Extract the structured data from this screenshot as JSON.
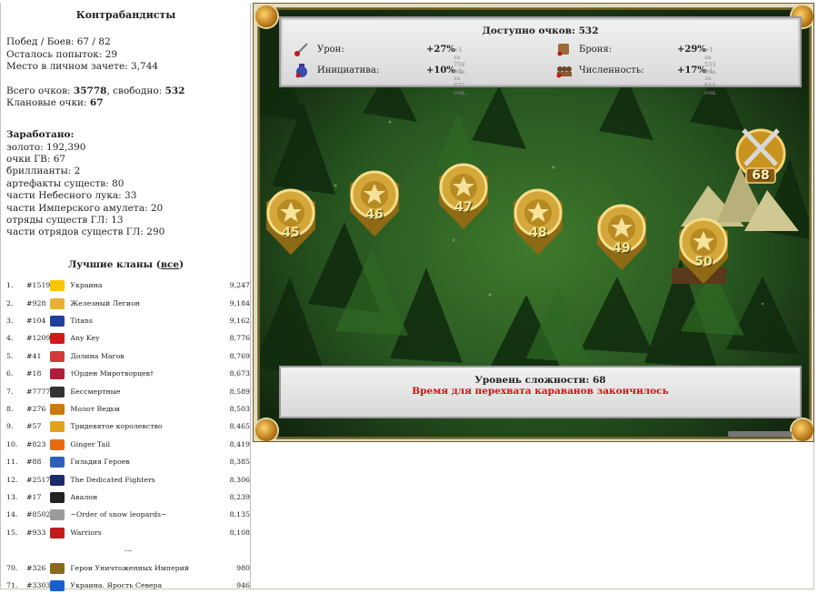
{
  "left": {
    "title": "Контрабандисты",
    "stats": [
      "Побед / Боев: 67 / 82",
      "Осталось попыток: 29",
      "Место в личном зачете: 3,744"
    ],
    "points_prefix": "Всего очков: ",
    "points_total": "35778",
    "points_mid": ", свободно: ",
    "points_free": "532",
    "clan_points_prefix": "Клановые очки: ",
    "clan_points": "67",
    "earned_title": "Заработано:",
    "earned": [
      "золото: 192,390",
      "очки ГВ: 67",
      "бриллианты: 2",
      "артефакты существ: 80",
      "части Небесного лука: 33",
      "части Имперского амулета: 20",
      "отряды существ ГЛ: 13",
      "части отрядов существ ГЛ: 290"
    ],
    "clans_title": "Лучшие кланы (",
    "clans_link": "все",
    "clans_title_end": ")",
    "clans": [
      {
        "rank": "1.",
        "id": "#1519",
        "name": "Украина",
        "score": "9,247",
        "color": "#f7c600",
        "icon": "ukraine-flag-icon"
      },
      {
        "rank": "2.",
        "id": "#928",
        "name": "Железный Легион",
        "score": "9,184",
        "color": "#e8b038",
        "icon": "smiley-icon"
      },
      {
        "rank": "3.",
        "id": "#104",
        "name": "Titans",
        "score": "9,162",
        "color": "#1f3f9a",
        "icon": "titans-icon"
      },
      {
        "rank": "4.",
        "id": "#1209",
        "name": "Any Key",
        "score": "8,776",
        "color": "#d01a1a",
        "icon": "at-sign-icon"
      },
      {
        "rank": "5.",
        "id": "#41",
        "name": "Долина Магов",
        "score": "8,769",
        "color": "#d23a3a",
        "icon": "star-icon"
      },
      {
        "rank": "6.",
        "id": "#18",
        "name": "†Орден Миротворцев†",
        "score": "8,673",
        "color": "#b01d3a",
        "icon": "flag-icon"
      },
      {
        "rank": "7.",
        "id": "#7777",
        "name": "Бессмертные",
        "score": "8,589",
        "color": "#333333",
        "icon": "bat-icon"
      },
      {
        "rank": "8.",
        "id": "#276",
        "name": "Молот Ведьм",
        "score": "8,503",
        "color": "#c97a10",
        "icon": "hammer-icon"
      },
      {
        "rank": "9.",
        "id": "#57",
        "name": "Тридевятое королевство",
        "score": "8,465",
        "color": "#e0a21a",
        "icon": "crown-icon"
      },
      {
        "rank": "10.",
        "id": "#823",
        "name": "Ginger Tail",
        "score": "8,419",
        "color": "#e86a10",
        "icon": "fox-icon"
      },
      {
        "rank": "11.",
        "id": "#88",
        "name": "Гильдия Героев",
        "score": "8,385",
        "color": "#2d5fb8",
        "icon": "shield-icon"
      },
      {
        "rank": "12.",
        "id": "#2517",
        "name": "The Dedicated Fighters",
        "score": "8,306",
        "color": "#1b2a6a",
        "icon": "fighters-icon"
      },
      {
        "rank": "13.",
        "id": "#17",
        "name": "Авалон",
        "score": "8,239",
        "color": "#222222",
        "icon": "knight-icon"
      },
      {
        "rank": "14.",
        "id": "#8502",
        "name": "~Order of snow leopards~",
        "score": "8,135",
        "color": "#9a9a9a",
        "icon": "leopard-icon"
      },
      {
        "rank": "15.",
        "id": "#933",
        "name": "Warriors",
        "score": "8,108",
        "color": "#c01a1a",
        "icon": "warriors-icon"
      }
    ],
    "ellipsis": "...",
    "clans_tail": [
      {
        "rank": "70.",
        "id": "#326",
        "name": "Герои Уничтоженных Империй",
        "score": "980",
        "color": "#8a6a20",
        "icon": "ankh-icon"
      },
      {
        "rank": "71.",
        "id": "#3303",
        "name": "Украина. Ярость Севера",
        "score": "946",
        "color": "#1a5fd0",
        "icon": "ukraine-flag-icon"
      }
    ]
  },
  "game": {
    "available_prefix": "Доступно очков: ",
    "available": "532",
    "stats": {
      "damage": {
        "label": "Урон:",
        "pct": "+27%",
        "cost": "+1 за 759 очк."
      },
      "armor": {
        "label": "Броня:",
        "pct": "+29%",
        "cost": "+1 за 533 очк."
      },
      "initiative": {
        "label": "Инициатива:",
        "pct": "+10%",
        "cost": "+1 за 677 очк."
      },
      "count": {
        "label": "Численность:",
        "pct": "+17%",
        "cost": "+1 за 644 очк."
      }
    },
    "difficulty_prefix": "Уровень сложности: ",
    "difficulty": "68",
    "message": "Время для перехвата караванов закончилось",
    "medals": [
      "45",
      "46",
      "47",
      "48",
      "49",
      "50"
    ],
    "active_medal": "68"
  }
}
